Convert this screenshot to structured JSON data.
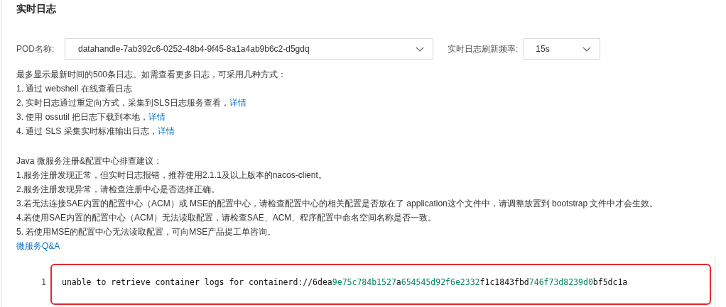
{
  "title": "实时日志",
  "pod": {
    "label": "POD名称:",
    "value": "datahandle-7ab392c6-0252-48b4-9f45-8a1a4ab9b6c2-d5gdq"
  },
  "refresh": {
    "label": "实时日志刷新频率:",
    "value": "15s"
  },
  "intro": "最多显示最新时间的500条日志。如需查看更多日志，可采用几种方式：",
  "methods": [
    {
      "text": "1. 通过 webshell 在线查看日志"
    },
    {
      "text": "2. 实时日志通过重定向方式，采集到SLS日志服务查看，",
      "link": "详情"
    },
    {
      "text": "3. 使用 ossutil 把日志下载到本地，",
      "link": "详情"
    },
    {
      "text": "4. 通过 SLS 采集实时标准输出日志，",
      "link": "详情"
    }
  ],
  "java_title": "Java 微服务注册&配置中心排查建议：",
  "java_tips": [
    "1.服务注册发现正常，但实时日志报错，推荐使用2.1.1及以上版本的nacos-client。",
    "2.服务注册发现异常，请检查注册中心是否选择正确。",
    "3.若无法连接SAE内置的配置中心（ACM）或 MSE的配置中心，请检查配置中心的相关配置是否放在了 application这个文件中，请调整放置到 bootstrap 文件中才会生效。",
    "4.若使用SAE内置的配置中心（ACM）无法读取配置，请检查SAE、ACM、程序配置中命名空间名称是否一致。",
    "5. 若使用MSE的配置中心无法读取配置，可向MSE产品提工单咨询。"
  ],
  "qa_link": "微服务Q&A",
  "log_lines": [
    {
      "number": "1",
      "segments": [
        {
          "kind": "plain",
          "text": "unable to retrieve container logs for containerd://6dea"
        },
        {
          "kind": "number",
          "text": "9e75c784b1527"
        },
        {
          "kind": "plain",
          "text": "a"
        },
        {
          "kind": "number",
          "text": "654545d92f6e2332"
        },
        {
          "kind": "plain",
          "text": "f1c1843fbd"
        },
        {
          "kind": "number",
          "text": "746f73d8239d0"
        },
        {
          "kind": "plain",
          "text": "bf5dc1a"
        }
      ]
    }
  ]
}
